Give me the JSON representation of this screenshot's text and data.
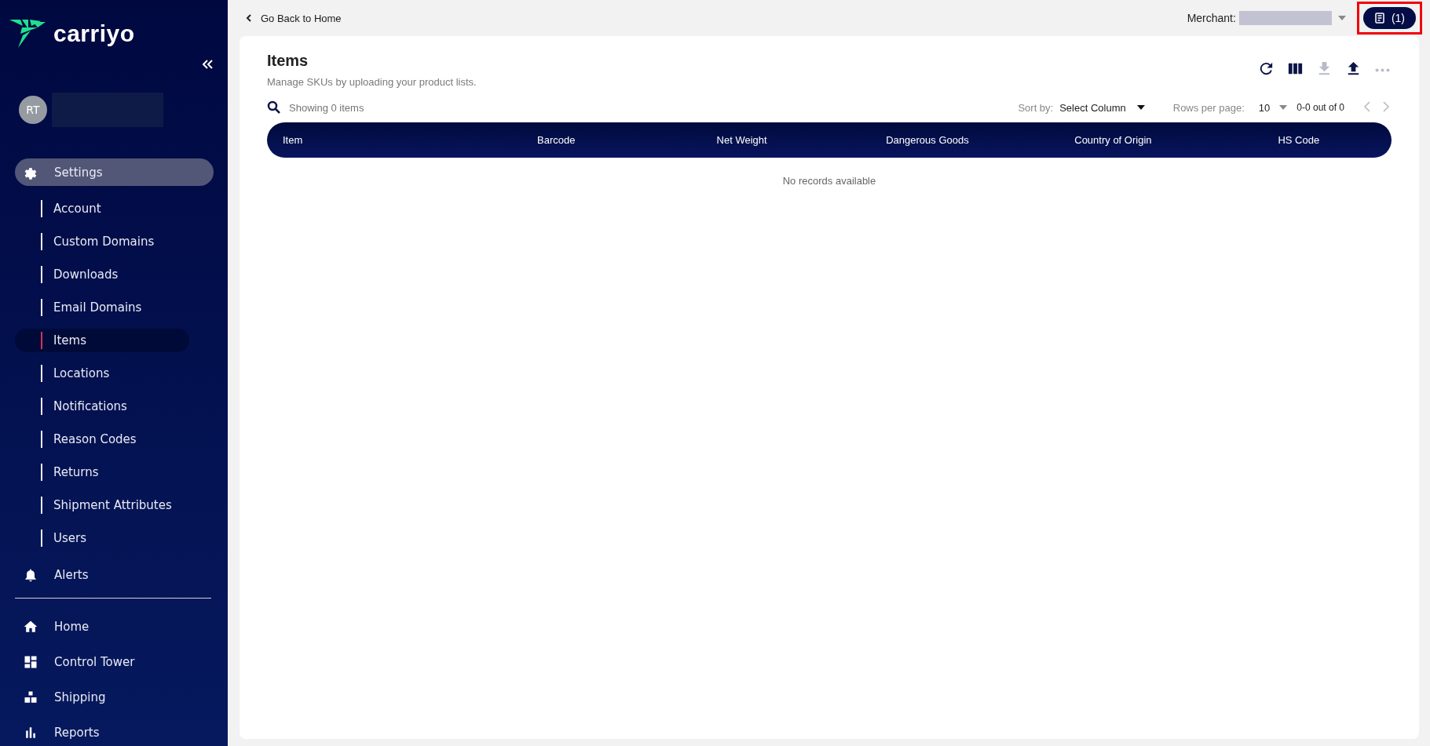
{
  "sidebar": {
    "brand": "carriyo",
    "user": {
      "initials": "RT"
    },
    "nav": [
      {
        "label": "Settings",
        "selected": true,
        "children": [
          {
            "label": "Account",
            "selected": false
          },
          {
            "label": "Custom Domains",
            "selected": false
          },
          {
            "label": "Downloads",
            "selected": false
          },
          {
            "label": "Email Domains",
            "selected": false
          },
          {
            "label": "Items",
            "selected": true
          },
          {
            "label": "Locations",
            "selected": false
          },
          {
            "label": "Notifications",
            "selected": false
          },
          {
            "label": "Reason Codes",
            "selected": false
          },
          {
            "label": "Returns",
            "selected": false
          },
          {
            "label": "Shipment Attributes",
            "selected": false
          },
          {
            "label": "Users",
            "selected": false
          }
        ]
      },
      {
        "label": "Alerts",
        "selected": false
      }
    ],
    "bottom_nav": [
      {
        "label": "Home",
        "selected": false
      },
      {
        "label": "Control Tower",
        "selected": false
      },
      {
        "label": "Shipping",
        "selected": false
      },
      {
        "label": "Reports",
        "selected": false
      }
    ]
  },
  "header": {
    "back_link": "Go Back to Home",
    "merchant_label": "Merchant:",
    "tasks_count": "(1)",
    "tasks_highlighted": true
  },
  "page": {
    "title": "Items",
    "subtitle": "Manage SKUs by uploading your product lists.",
    "toolbar": [
      {
        "disabled": false
      },
      {
        "disabled": false
      },
      {
        "disabled": true
      },
      {
        "disabled": false
      },
      {
        "disabled": true
      }
    ],
    "search": {
      "placeholder": "Showing 0 items"
    },
    "sort": {
      "label": "Sort by:",
      "value": "Select Column"
    },
    "pager": {
      "label": "Rows per page:",
      "value": "10",
      "range": "0-0 out of 0",
      "prev_disabled": true,
      "next_disabled": true
    },
    "table": {
      "columns": [
        "Item",
        "Barcode",
        "Net Weight",
        "Dangerous Goods",
        "Country of Origin",
        "HS Code"
      ],
      "empty_text": "No records available"
    }
  }
}
